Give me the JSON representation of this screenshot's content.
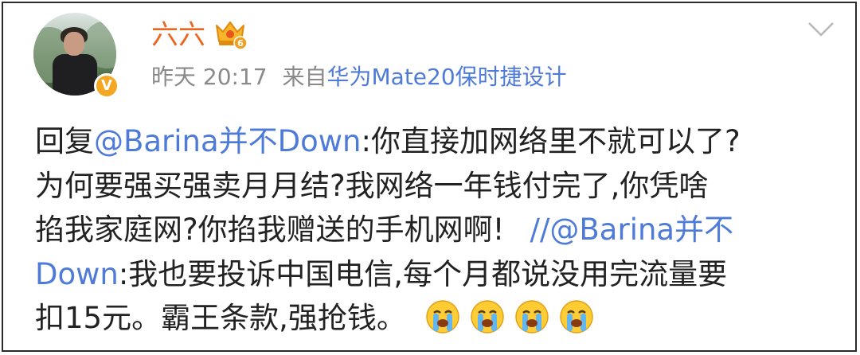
{
  "post": {
    "author": "六六",
    "timestamp": "昨天 20:17",
    "source_prefix": "来自",
    "source": "华为Mate20保时捷设计",
    "verified_icon": "verified-v-icon",
    "member_icon": "crown-member-icon",
    "menu_icon": "chevron-down-icon",
    "crown_level": "6",
    "verified_glyph": "V",
    "colors": {
      "author": "#e86722",
      "link": "#4f7bd8",
      "meta": "#8a8a8a",
      "text": "#222222"
    }
  },
  "content": {
    "l1_prefix": "回复",
    "l1_mention": "@Barina并不Down",
    "l1_text": ":你直接加网络里不就可以了?",
    "l2_text": "为何要强买强卖月月结?我网络一年钱付完了,你凭啥",
    "l3_text": "掐我家庭网?你掐我赠送的手机网啊!",
    "l3_sep": "//",
    "l3_mention": "@Barina并不",
    "l4_mention": "Down",
    "l4_text": ":我也要投诉中国电信,每个月都说没用完流量要",
    "l5_text": "扣15元。霸王条款,强抢钱。",
    "emojis": [
      "crying-face-emoji",
      "crying-face-emoji",
      "crying-face-emoji",
      "crying-face-emoji"
    ]
  }
}
